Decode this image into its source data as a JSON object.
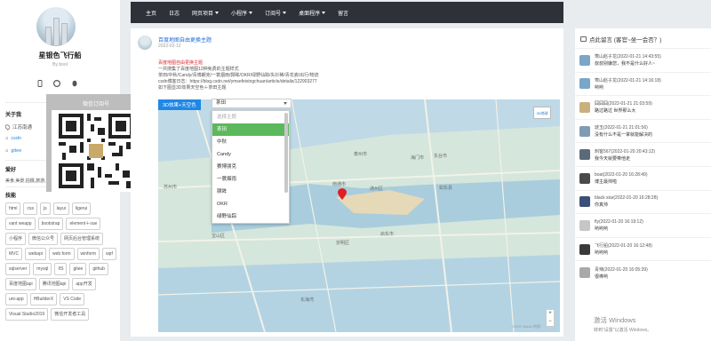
{
  "colors": {
    "nav_bg": "#2e3138",
    "accent_blue": "#1e88e5",
    "selected_green": "#5cb85c",
    "title_red": "#d9282c"
  },
  "profile": {
    "name": "星银色飞行船",
    "subtitle": "By bool"
  },
  "about": {
    "title": "关于我",
    "location": "江苏南通",
    "link1": "csdn",
    "link2": "gitee"
  },
  "hobby": {
    "title": "爱好",
    "text": "美食,美景,拍摄,旅游,文学,编程"
  },
  "skills": {
    "title": "技能",
    "tags": [
      "html",
      "css",
      "js",
      "layui",
      "ligerui",
      "vant weapp",
      "bootstrap",
      "element＋vue",
      "小程序",
      "微信公众号",
      "网页后台管理系统",
      "MVC",
      "webapi",
      "web form",
      "winform",
      "wpf",
      "sqlserver",
      "mysql",
      "IIS",
      "gitee",
      "github",
      "百度地图api",
      "腾讯地图api",
      "app开发",
      "uni-app",
      "HBuilderX",
      "VS Code",
      "Visual Studio2019",
      "微信开发者工具"
    ]
  },
  "qr": {
    "title": "微信订阅号"
  },
  "nav": {
    "items": [
      {
        "label": "主页",
        "dropdown": false
      },
      {
        "label": "日志",
        "dropdown": false
      },
      {
        "label": "网页项目",
        "dropdown": true
      },
      {
        "label": "小程序",
        "dropdown": true
      },
      {
        "label": "订阅号",
        "dropdown": true
      },
      {
        "label": "桌面程序",
        "dropdown": true
      },
      {
        "label": "留言",
        "dropdown": false
      }
    ]
  },
  "post": {
    "title": "百度地图自由更换主题",
    "date": "2022-02-12",
    "heading": "百度地图自由更换主题",
    "line1": "一共搜集了百度地图12种免费的主题样式",
    "line2": "茶田/中秋/Candy/青博朗克/一蓑烟雨/颢眸/OKR/绿野仙踪/失衫稀/青花瓷/出行/物流",
    "line3": "csdn博客日志：https://blog.csdn.net/ymsefeixingchuan/article/details/122903277",
    "line4": "如下图显3D效果天空色＋茶田主题"
  },
  "map": {
    "tag": "3D效果+天空色",
    "btn3d": "3D地球",
    "copyright": "©2022 Baidu 地图",
    "labels": [
      "苏州市",
      "南通市",
      "通州区",
      "如东县",
      "海门市",
      "启东市",
      "崇明区",
      "宝山区",
      "东海湾",
      "泰州市",
      "东台市"
    ]
  },
  "select": {
    "value": "茶田",
    "options": [
      {
        "label": "选择主题",
        "state": "disabled"
      },
      {
        "label": "茶田",
        "state": "selected"
      },
      {
        "label": "中秋",
        "state": "normal"
      },
      {
        "label": "Candy",
        "state": "normal"
      },
      {
        "label": "赛博朋克",
        "state": "normal"
      },
      {
        "label": "一蓑烟雨",
        "state": "normal"
      },
      {
        "label": "颢眸",
        "state": "normal"
      },
      {
        "label": "OKR",
        "state": "normal"
      },
      {
        "label": "绿野仙踪",
        "state": "normal"
      }
    ]
  },
  "comments": {
    "title": "点此留言 (客官~坐一会否？)",
    "items": [
      {
        "name": "莺山赵子龙(2022-01-21 14:43:55)",
        "msg": "叔叔别嫌您，我不是什么好人~",
        "color": "#7aa6c8"
      },
      {
        "name": "莺山赵子龙(2022-01-21 14:16:18)",
        "msg": "哟哟",
        "color": "#7aa6c8"
      },
      {
        "name": "囧囧囧(2022-01-21 21:03:59)",
        "msg": "路过路过 世界那么大",
        "color": "#c9b07d"
      },
      {
        "name": "琥玉(2022-01-21 21:01:56)",
        "msg": "没有什么不是一掌就能解决的",
        "color": "#7f9cb5"
      },
      {
        "name": "刺客567(2022-01-20 20:43:12)",
        "msg": "我今天就要带他走",
        "color": "#5b6a7a"
      },
      {
        "name": "boat(2022-01-20 16:28:49)",
        "msg": "博主最帅啦",
        "color": "#4a4a4a"
      },
      {
        "name": "black star(2022-01-20 16:28:28)",
        "msg": "你真帅",
        "color": "#3b4f78"
      },
      {
        "name": "fly(2022-01-20 16:19:12)",
        "msg": "哟哟哟",
        "color": "#c6c6c6"
      },
      {
        "name": "飞行船(2022-01-20 16:12:48)",
        "msg": "哟哟哟",
        "color": "#3a3a3a"
      },
      {
        "name": "青辣(2022-01-20 16:05:39)",
        "msg": "很棒哟",
        "color": "#a9a9a9"
      }
    ]
  },
  "activate": {
    "line1": "激活 Windows",
    "line2": "转到\"设置\"以激活 Windows。"
  }
}
